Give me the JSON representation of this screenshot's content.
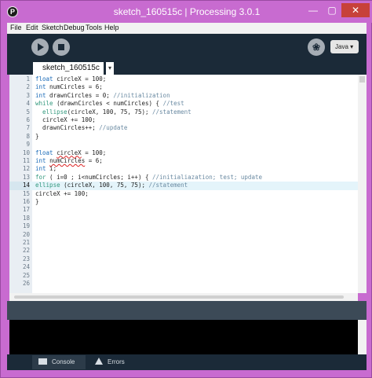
{
  "window": {
    "title": "sketch_160515c | Processing 3.0.1",
    "app_icon_letter": "P",
    "controls": {
      "minimize": "—",
      "maximize": "▢",
      "close": "✕"
    }
  },
  "menu": [
    "File",
    "Edit",
    "Sketch",
    "Debug",
    "Tools",
    "Help"
  ],
  "toolbar": {
    "run_icon": "play-icon",
    "stop_icon": "stop-icon",
    "debugger_icon": "butterfly-icon",
    "debugger_glyph": "❀",
    "mode_label": "Java ▾"
  },
  "tabs": {
    "active_label": "sketch_160515c",
    "menu_glyph": "▾"
  },
  "editor": {
    "highlight_line": 14,
    "lines": [
      {
        "n": "1",
        "html": "<span class='kw'>float</span> circleX = 100;"
      },
      {
        "n": "2",
        "html": "<span class='kw'>int</span> numCircles = 6;"
      },
      {
        "n": "3",
        "html": "<span class='kw'>int</span> drawnCircles = 0; <span class='cm'>//initialization</span>"
      },
      {
        "n": "4",
        "html": "<span class='kw2'>while</span> (drawnCircles &lt; numCircles) { <span class='cm'>//test</span>"
      },
      {
        "n": "5",
        "html": "  <span class='kw2'>ellipse</span>(circleX, 100, 75, 75); <span class='cm'>//statement</span>"
      },
      {
        "n": "6",
        "html": "  circleX += 100;"
      },
      {
        "n": "7",
        "html": "  drawnCircles++; <span class='cm'>//update</span>"
      },
      {
        "n": "8",
        "html": "}"
      },
      {
        "n": "9",
        "html": ""
      },
      {
        "n": "10",
        "html": "<span class='kw'>float</span> <span class='err'>circleX</span> = 100;"
      },
      {
        "n": "11",
        "html": "<span class='kw'>int</span> <span class='err'>numCircles</span> = 6;"
      },
      {
        "n": "12",
        "html": "<span class='kw'>int</span> i;"
      },
      {
        "n": "13",
        "html": "<span class='kw2'>for</span> ( i=0 ; i&lt;numCircles; i++) { <span class='cm'>//initialiazation; test; update</span>"
      },
      {
        "n": "14",
        "html": "<span class='kw2'>ellipse</span> (circleX, 100, 75, 75); <span class='cm'>//statement</span>"
      },
      {
        "n": "15",
        "html": "circleX += 100;"
      },
      {
        "n": "16",
        "html": "}"
      },
      {
        "n": "17",
        "html": ""
      },
      {
        "n": "18",
        "html": ""
      },
      {
        "n": "19",
        "html": ""
      },
      {
        "n": "20",
        "html": ""
      },
      {
        "n": "21",
        "html": ""
      },
      {
        "n": "22",
        "html": ""
      },
      {
        "n": "23",
        "html": ""
      },
      {
        "n": "24",
        "html": ""
      },
      {
        "n": "25",
        "html": ""
      },
      {
        "n": "26",
        "html": ""
      }
    ]
  },
  "bottom_tabs": {
    "console_label": "Console",
    "errors_label": "Errors"
  }
}
